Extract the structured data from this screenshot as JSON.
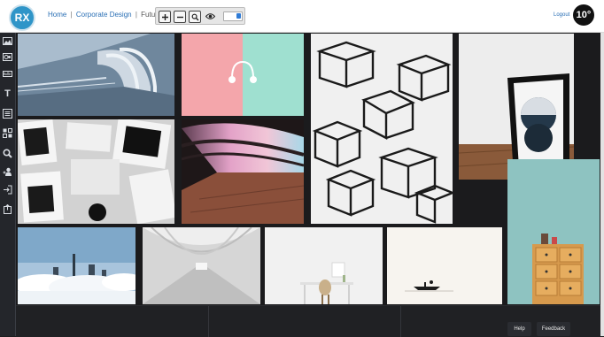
{
  "header": {
    "logo_text": "RX",
    "breadcrumb": {
      "home": "Home",
      "section": "Corporate Design",
      "current": "Futuristic",
      "separator": "|"
    },
    "toolbar": {
      "zoom_in_icon": "plus-square-icon",
      "zoom_out_icon": "minus-square-icon",
      "search_icon": "magnifier-icon",
      "view_icon": "eye-icon"
    },
    "logout_label": "Logout",
    "avatar_text": "10°"
  },
  "sidebar": {
    "items": [
      {
        "name": "image-icon"
      },
      {
        "name": "film-icon"
      },
      {
        "name": "video-icon"
      },
      {
        "name": "text-icon",
        "glyph": "T"
      },
      {
        "name": "list-icon"
      },
      {
        "name": "layout-icon"
      },
      {
        "name": "search-icon"
      },
      {
        "name": "add-user-icon"
      },
      {
        "name": "sign-in-icon"
      },
      {
        "name": "share-icon"
      }
    ]
  },
  "gallery": {
    "images": [
      {
        "name": "curved-tunnel-walkway"
      },
      {
        "name": "pink-mint-headphones"
      },
      {
        "name": "wireframe-cubes"
      },
      {
        "name": "framed-abstract-art"
      },
      {
        "name": "white-typography-posters"
      },
      {
        "name": "neon-curved-corridor"
      },
      {
        "name": "cloud-city-skyline"
      },
      {
        "name": "white-arched-hall"
      },
      {
        "name": "minimal-desk-chair"
      },
      {
        "name": "boat-on-calm-water"
      },
      {
        "name": "wooden-drawer-cabinet"
      }
    ]
  },
  "footer": {
    "help_label": "Help",
    "feedback_label": "Feedback"
  },
  "colors": {
    "accent": "#2f95c8",
    "sidebar_bg": "#24262b",
    "canvas_bg": "#1b1b1d"
  }
}
